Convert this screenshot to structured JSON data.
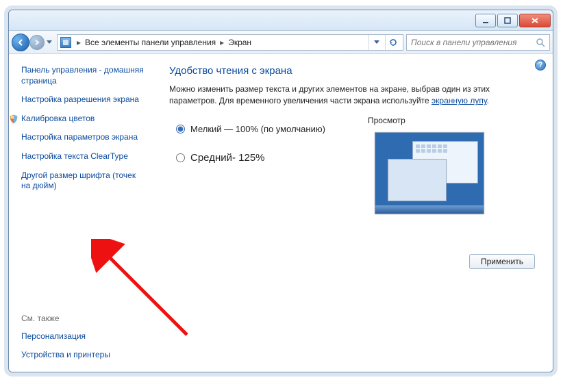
{
  "titlebar": {},
  "nav": {
    "breadcrumb": {
      "item1": "Все элементы панели управления",
      "item2": "Экран"
    },
    "search_placeholder": "Поиск в панели управления"
  },
  "sidebar": {
    "home": "Панель управления - домашняя страница",
    "links": [
      "Настройка разрешения экрана",
      "Калибровка цветов",
      "Настройка параметров экрана",
      "Настройка текста ClearType",
      "Другой размер шрифта (точек на дюйм)"
    ],
    "see_also_label": "См. также",
    "see_also": [
      "Персонализация",
      "Устройства и принтеры"
    ]
  },
  "main": {
    "heading": "Удобство чтения с экрана",
    "desc_part1": "Можно изменить размер текста и других элементов на экране, выбрав один из этих параметров. Для временного увеличения части экрана используйте ",
    "desc_link": "экранную лупу",
    "desc_part2": ".",
    "option_small": "Мелкий — 100% (по умолчанию)",
    "option_medium": "Средний- 125%",
    "preview_label": "Просмотр",
    "apply_label": "Применить"
  }
}
